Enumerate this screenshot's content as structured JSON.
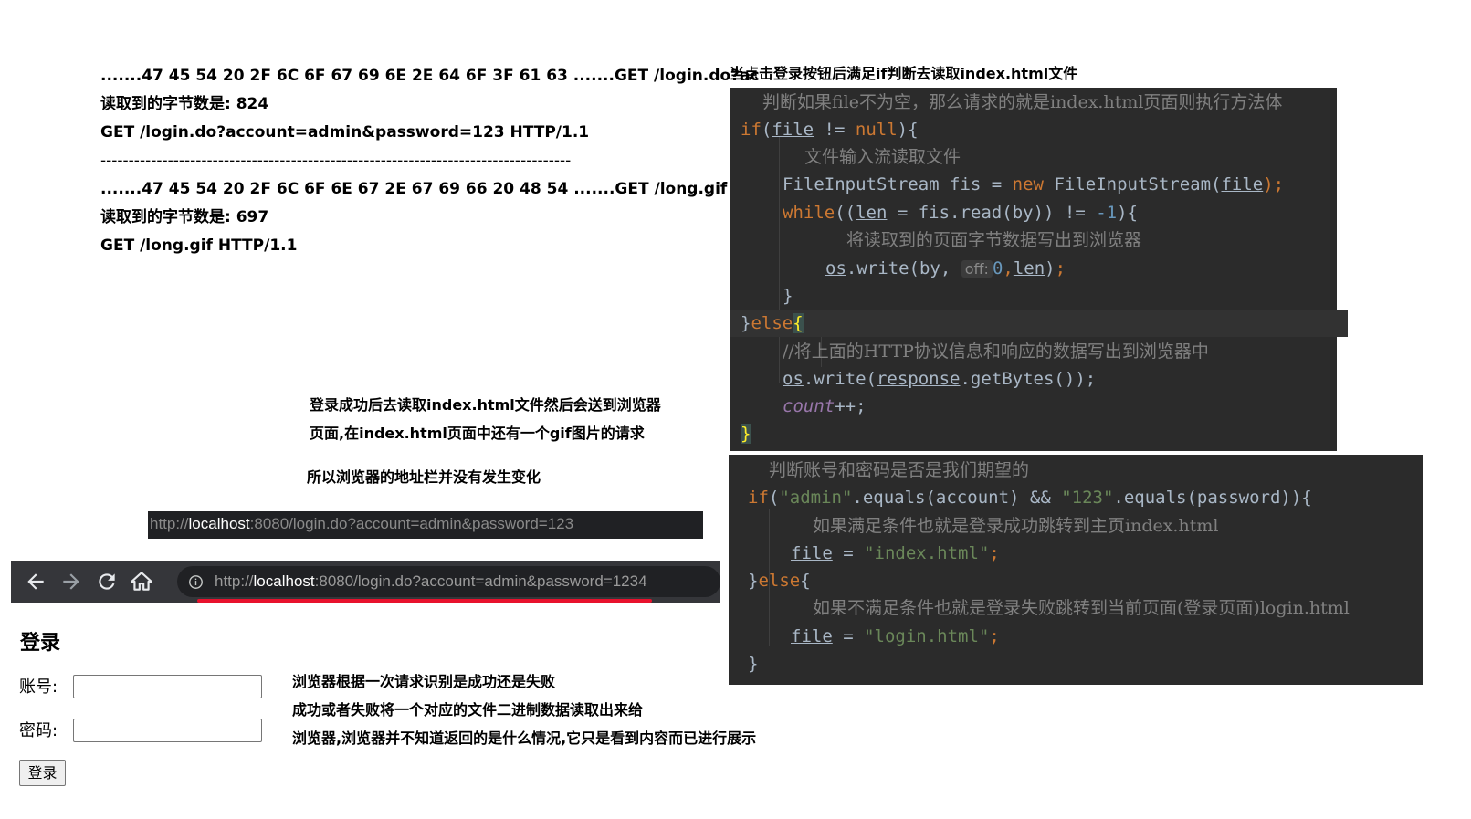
{
  "left_notes": {
    "lines": [
      ".......47 45 54 20 2F 6C 6F 67  69 6E 2E 64 6F 3F 61 63  .......GET /login.do?ac",
      "读取到的字节数是: 824",
      "GET /login.do?account=admin&password=123 HTTP/1.1",
      "------------------------------------------------------------------------------------",
      ".......47 45 54 20 2F 6C 6F 6E  67 2E 67 69 66 20 48 54  .......GET /long.gif HT",
      "读取到的字节数是: 697",
      "GET /long.gif HTTP/1.1"
    ]
  },
  "top_right_heading": "当点击登录按钮后满足if判断去读取index.html文件",
  "code_block_1": {
    "comment1": "判断如果file不为空，那么请求的就是index.html页面则执行方法体",
    "if_kw": "if",
    "file_var": "file",
    "neq_null": " != ",
    "null_kw": "null",
    "brace_open": "){",
    "comment2": "文件输入流读取文件",
    "fis_decl": "FileInputStream fis = ",
    "new_kw": "new",
    "fis_ctor": " FileInputStream(",
    "fis_end": ");",
    "while_kw": "while",
    "while_open": "((",
    "len_var": "len",
    "while_mid": " = fis.read(by)) != ",
    "minus_one": "-1",
    "while_end": "){",
    "comment3": "将读取到的页面字节数据写出到浏览器",
    "os_var": "os",
    "write_call": ".write(by, ",
    "off_hint": "off:",
    "zero": "0",
    "comma": ",",
    "write_end": ");",
    "close_brace": "}",
    "else_open": "}",
    "else_kw": "else",
    "else_brace": "{",
    "comment4": "//将上面的HTTP协议信息和响应的数据写出到浏览器中",
    "response_var": "response",
    "getbytes": ".getBytes());",
    "count_field": "count",
    "count_incr": "++;",
    "final_brace": "}"
  },
  "code_block_2": {
    "comment1": "判断账号和密码是否是我们期望的",
    "if_kw": "if",
    "str_admin": "\"admin\"",
    "equals_account": ".equals(account) && ",
    "str_123": "\"123\"",
    "equals_password": ".equals(password)){",
    "comment2": "如果满足条件也就是登录成功跳转到主页index.html",
    "file_var": "file",
    "assign": " = ",
    "str_index": "\"index.html\"",
    "semi": ";",
    "else_close": "}",
    "else_kw": "else",
    "else_brace": "{",
    "comment3": "如果不满足条件也就是登录失败跳转到当前页面(登录页面)login.html",
    "str_login": "\"login.html\"",
    "end_brace": "}"
  },
  "middle_notes": {
    "line1": "登录成功后去读取index.html文件然后会送到浏览器",
    "line2": "页面,在index.html页面中还有一个gif图片的请求",
    "line3": "所以浏览器的地址栏并没有发生变化"
  },
  "url_snippet": {
    "scheme": "http://",
    "host": "localhost",
    "rest": ":8080/login.do?account=admin&password=123"
  },
  "browser": {
    "back_icon": "arrow-left-icon",
    "forward_icon": "arrow-right-icon",
    "reload_icon": "reload-icon",
    "home_icon": "home-icon",
    "info_icon": "info-icon",
    "url_scheme": "http://",
    "url_host": "localhost",
    "url_rest": ":8080/login.do?account=admin&password=1234"
  },
  "login_form": {
    "title": "登录",
    "account_label": "账号:",
    "account_value": "",
    "password_label": "密码:",
    "password_value": "",
    "submit_label": "登录"
  },
  "bottom_notes": {
    "line1": "浏览器根据一次请求识别是成功还是失败",
    "line2": "成功或者失败将一个对应的文件二进制数据读取出来给",
    "line3": "浏览器,浏览器并不知道返回的是什么情况,它只是看到内容而已进行展示"
  },
  "colors": {
    "code_bg": "#2b2b2b",
    "keyword": "#cc7832",
    "string": "#6a8759",
    "number": "#6897bb",
    "comment": "#808080",
    "field": "#9876aa",
    "text": "#a9b7c6",
    "underline_red": "#e8112d",
    "toolbar": "#35363a"
  }
}
